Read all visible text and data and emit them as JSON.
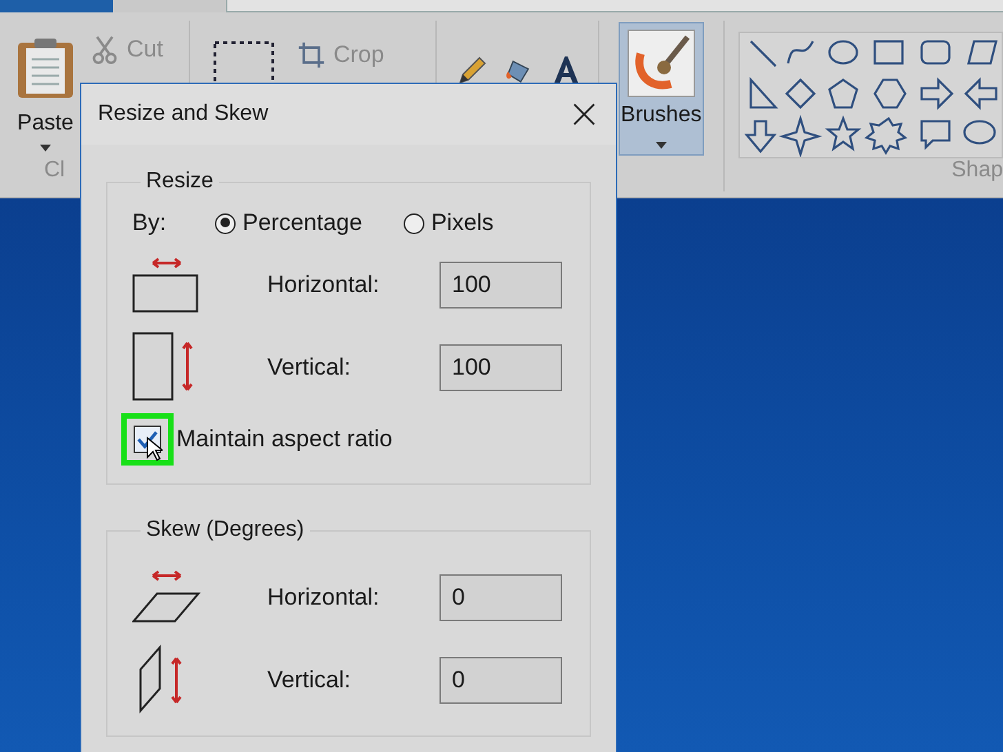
{
  "ribbon": {
    "paste": "Paste",
    "cut": "Cut",
    "crop": "Crop",
    "clipboard_label": "Cl",
    "brushes": {
      "label": "Brushes",
      "selected": true
    },
    "shapes_label": "Shap"
  },
  "dialog": {
    "title": "Resize and Skew",
    "resize": {
      "title": "Resize",
      "by_label": "By:",
      "options": [
        {
          "label": "Percentage",
          "selected": true
        },
        {
          "label": "Pixels",
          "selected": false
        }
      ],
      "fields": [
        {
          "kind": "horizontal",
          "label": "Horizontal:",
          "value": "100"
        },
        {
          "kind": "vertical",
          "label": "Vertical:",
          "value": "100"
        }
      ],
      "maintain": {
        "label": "Maintain aspect ratio",
        "checked": true
      }
    },
    "skew": {
      "title": "Skew (Degrees)",
      "fields": [
        {
          "kind": "horizontal",
          "label": "Horizontal:",
          "value": "0"
        },
        {
          "kind": "vertical",
          "label": "Vertical:",
          "value": "0"
        }
      ]
    }
  }
}
